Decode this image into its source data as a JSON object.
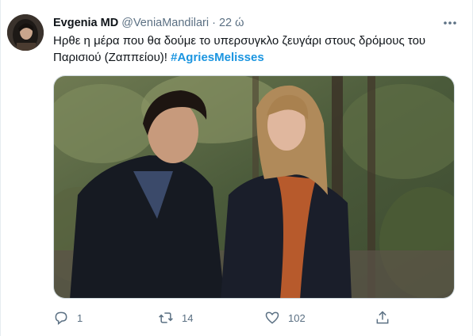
{
  "tweet": {
    "display_name": "Evgenia MD",
    "handle": "@VeniaMandilari",
    "separator": "·",
    "time": "22 ώ",
    "text_line1": "Ηρθε η μέρα που θα δούμε το υπερσυγκλο ζευγάρι στους δρόμους του",
    "text_line2": "Παρισιού (Ζαππείου)! ",
    "hashtag": "#AgriesMelisses",
    "media_description": "photo"
  },
  "actions": {
    "reply_count": "1",
    "retweet_count": "14",
    "like_count": "102",
    "icons": [
      "reply-icon",
      "retweet-icon",
      "like-icon",
      "share-icon"
    ]
  },
  "colors": {
    "hashtag": "#1b95e0",
    "muted": "#5b7083",
    "text": "#0f1419"
  }
}
